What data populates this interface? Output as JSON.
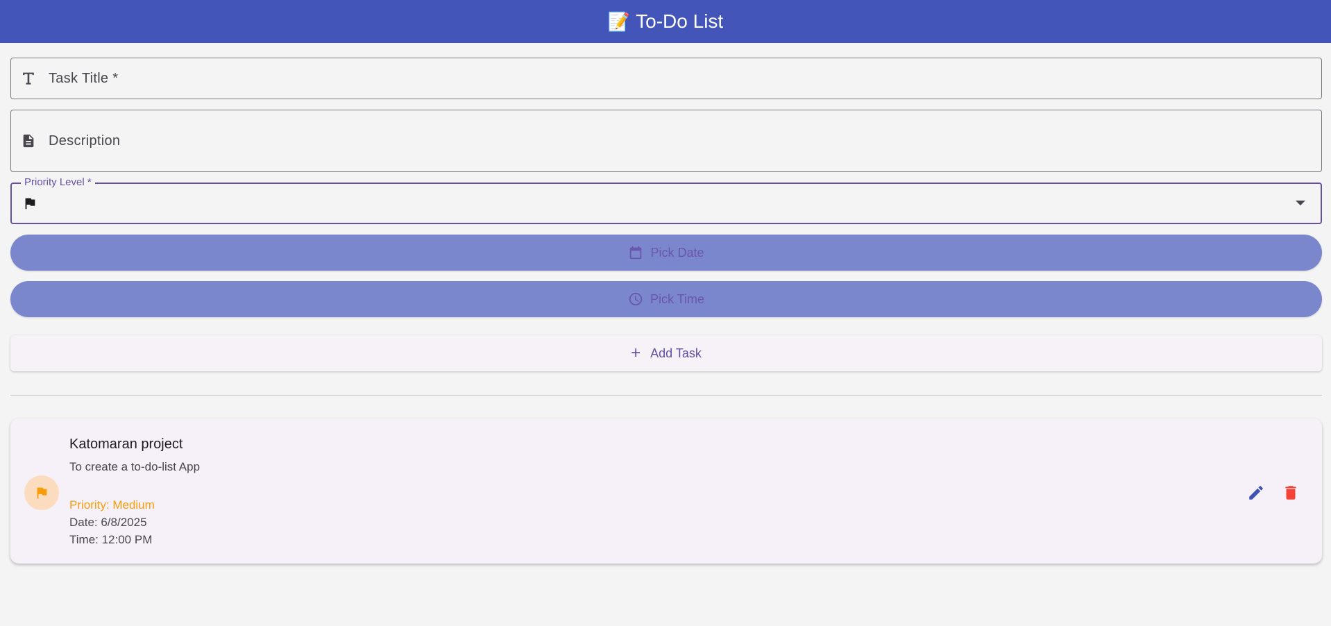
{
  "appbar": {
    "emoji": "📝",
    "title": "To-Do List"
  },
  "form": {
    "title_placeholder": "Task Title *",
    "description_placeholder": "Description",
    "priority_label": "Priority Level *",
    "priority_value": "",
    "pick_date_label": "Pick Date",
    "pick_time_label": "Pick Time",
    "add_task_label": "Add Task"
  },
  "tasks": [
    {
      "title": "Katomaran project",
      "description": "To create a to-do-list App",
      "priority": "Priority: Medium",
      "date": "Date: 6/8/2025",
      "time": "Time: 12:00 PM"
    }
  ],
  "colors": {
    "appbar": "#4355b8",
    "pill": "#7a87cc",
    "accent": "#6750a4",
    "priority_medium": "#f59c0b",
    "delete": "#f44336",
    "edit": "#3f51b5"
  },
  "icons": {
    "title": "text-fields-icon",
    "description": "description-icon",
    "priority": "flag-icon",
    "date": "calendar-icon",
    "time": "clock-icon",
    "add": "plus-icon",
    "edit": "edit-icon",
    "delete": "delete-icon"
  }
}
